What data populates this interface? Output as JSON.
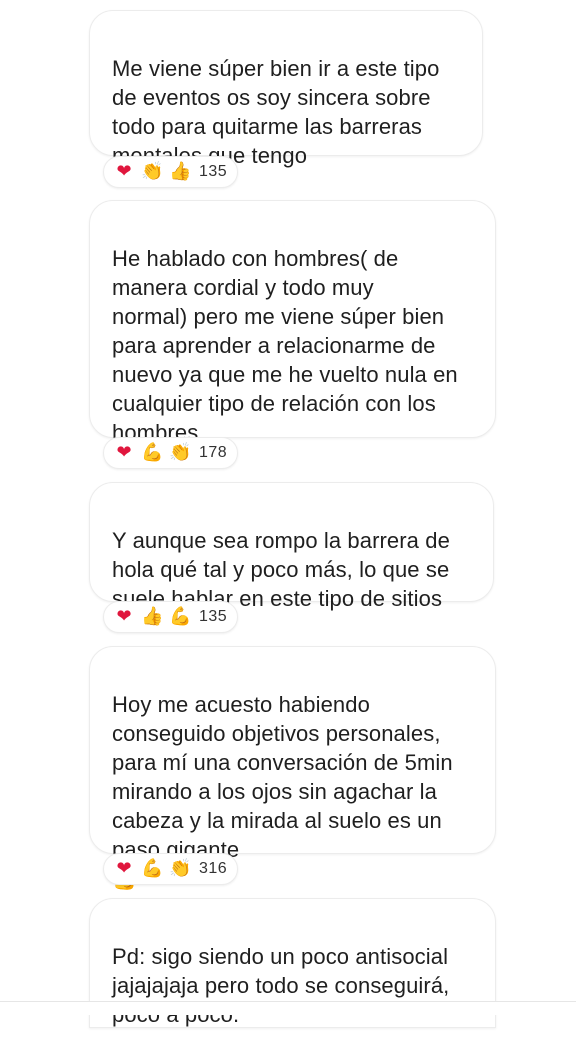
{
  "messages": [
    {
      "text": "Me viene súper bien ir a este tipo\nde eventos os soy sincera sobre\ntodo para quitarme las barreras\nmentales que tengo",
      "reactions": [
        {
          "icon": "red-heart",
          "glyph": "❤"
        },
        {
          "icon": "clapping-hands",
          "glyph": "👏"
        },
        {
          "icon": "thumbs-up",
          "glyph": "👍"
        }
      ],
      "count": "135"
    },
    {
      "text": "He hablado con hombres( de\nmanera cordial y todo muy\nnormal) pero me viene súper bien\npara aprender a relacionarme de\nnuevo ya que me he vuelto nula en\ncualquier tipo de relación con los\nhombres",
      "reactions": [
        {
          "icon": "red-heart",
          "glyph": "❤"
        },
        {
          "icon": "flexed-biceps",
          "glyph": "💪"
        },
        {
          "icon": "clapping-hands",
          "glyph": "👏"
        }
      ],
      "count": "178"
    },
    {
      "text": "Y aunque sea rompo la barrera de\nhola qué tal y poco más, lo que se\nsuele hablar en este tipo de sitios",
      "reactions": [
        {
          "icon": "red-heart",
          "glyph": "❤"
        },
        {
          "icon": "thumbs-up",
          "glyph": "👍"
        },
        {
          "icon": "flexed-biceps",
          "glyph": "💪"
        }
      ],
      "count": "135"
    },
    {
      "text": "Hoy me acuesto habiendo\nconseguido objetivos personales,\npara mí una conversación de 5min\nmirando a los ojos sin agachar la\ncabeza y la mirada al suelo es un\npaso gigante",
      "inline_emoji": {
        "icon": "flexed-biceps-light-skin",
        "glyph": "💪"
      },
      "reactions": [
        {
          "icon": "red-heart",
          "glyph": "❤"
        },
        {
          "icon": "flexed-biceps",
          "glyph": "💪"
        },
        {
          "icon": "clapping-hands",
          "glyph": "👏"
        }
      ],
      "count": "316"
    },
    {
      "text": "Pd: sigo siendo un poco antisocial\njajajajaja pero todo se conseguirá,\npoco a poco."
    }
  ]
}
